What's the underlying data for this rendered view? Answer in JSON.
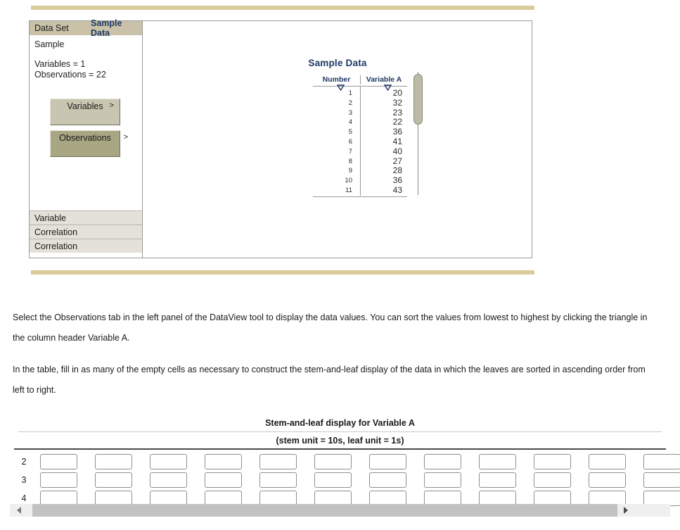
{
  "dataview": {
    "tabs": {
      "data_set_label": "Data Set",
      "sample_data_label": "Sample Data"
    },
    "sample_name": "Sample",
    "variables_line": "Variables = 1",
    "observations_line": "Observations = 22",
    "buttons": {
      "variables_label": "Variables",
      "variables_caret": ">",
      "observations_label": "Observations",
      "observations_caret": ">"
    },
    "bottom_tabs": [
      "Variable",
      "Correlation",
      "Correlation"
    ],
    "table": {
      "title": "Sample Data",
      "headers": [
        "Number",
        "Variable A"
      ],
      "sort_icon": "sort-triangle-down",
      "rows": [
        {
          "number": "1",
          "value": "20"
        },
        {
          "number": "2",
          "value": "32"
        },
        {
          "number": "3",
          "value": "23"
        },
        {
          "number": "4",
          "value": "22"
        },
        {
          "number": "5",
          "value": "36"
        },
        {
          "number": "6",
          "value": "41"
        },
        {
          "number": "7",
          "value": "40"
        },
        {
          "number": "8",
          "value": "27"
        },
        {
          "number": "9",
          "value": "28"
        },
        {
          "number": "10",
          "value": "36"
        },
        {
          "number": "11",
          "value": "43"
        }
      ]
    }
  },
  "instructions": {
    "p1": "Select the Observations tab in the left panel of the DataView tool to display the data values. You can sort the values from lowest to highest by clicking the triangle in the column header Variable A.",
    "p2": "In the table, fill in as many of the empty cells as necessary to construct the stem-and-leaf display of the data in which the leaves are sorted in ascending order from left to right."
  },
  "stem_and_leaf": {
    "title": "Stem-and-leaf display for Variable A",
    "subtitle": "(stem unit = 10s, leaf unit = 1s)",
    "stems": [
      "2",
      "3",
      "4"
    ],
    "cells_per_row": 12,
    "cell_values": [
      [
        "",
        "",
        "",
        "",
        "",
        "",
        "",
        "",
        "",
        "",
        "",
        ""
      ],
      [
        "",
        "",
        "",
        "",
        "",
        "",
        "",
        "",
        "",
        "",
        "",
        ""
      ],
      [
        "",
        "",
        "",
        "",
        "",
        "",
        "",
        "",
        "",
        "",
        "",
        ""
      ]
    ]
  },
  "scrollbars": {
    "horizontal_left_arrow": "triangle-left",
    "horizontal_right_arrow": "triangle-right"
  },
  "colors": {
    "tan_rule": "#d9cc9a",
    "tab_bar": "#c9c2a8",
    "accent_navy": "#1f3864",
    "button_active": "#a9a783",
    "button_idle": "#c8c6b0"
  }
}
